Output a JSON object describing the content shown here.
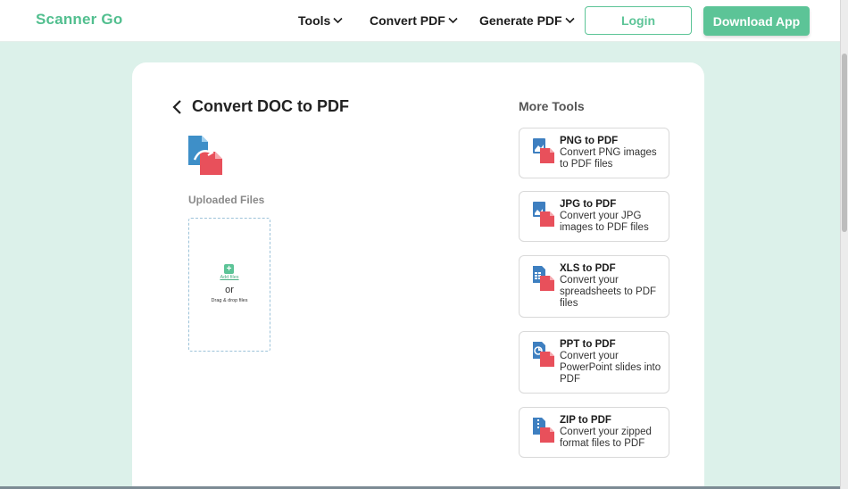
{
  "header": {
    "logo": "Scanner Go",
    "nav": [
      {
        "label": "Tools"
      },
      {
        "label": "Convert PDF"
      },
      {
        "label": "Generate PDF"
      }
    ],
    "login_label": "Login",
    "download_label": "Download App"
  },
  "main": {
    "title": "Convert DOC to PDF",
    "uploaded_label": "Uploaded Files",
    "dropzone": {
      "add_label": "Add files",
      "or_label": "or",
      "drag_label": "Drag & drop files"
    }
  },
  "more_tools": {
    "title": "More Tools",
    "items": [
      {
        "name": "PNG to PDF",
        "desc": "Convert PNG images to PDF files",
        "icon": "png-file-icon"
      },
      {
        "name": "JPG to PDF",
        "desc": "Convert your JPG images to PDF files",
        "icon": "jpg-file-icon"
      },
      {
        "name": "XLS to PDF",
        "desc": "Convert your spreadsheets to PDF files",
        "icon": "xls-file-icon"
      },
      {
        "name": "PPT to PDF",
        "desc": "Convert your PowerPoint slides into PDF",
        "icon": "ppt-file-icon"
      },
      {
        "name": "ZIP to PDF",
        "desc": "Convert your zipped format files to PDF",
        "icon": "zip-file-icon"
      }
    ]
  },
  "colors": {
    "brand": "#5cc497",
    "background": "#dcf1ea",
    "pdf_red": "#e8505b",
    "doc_blue": "#3e8fc8"
  }
}
